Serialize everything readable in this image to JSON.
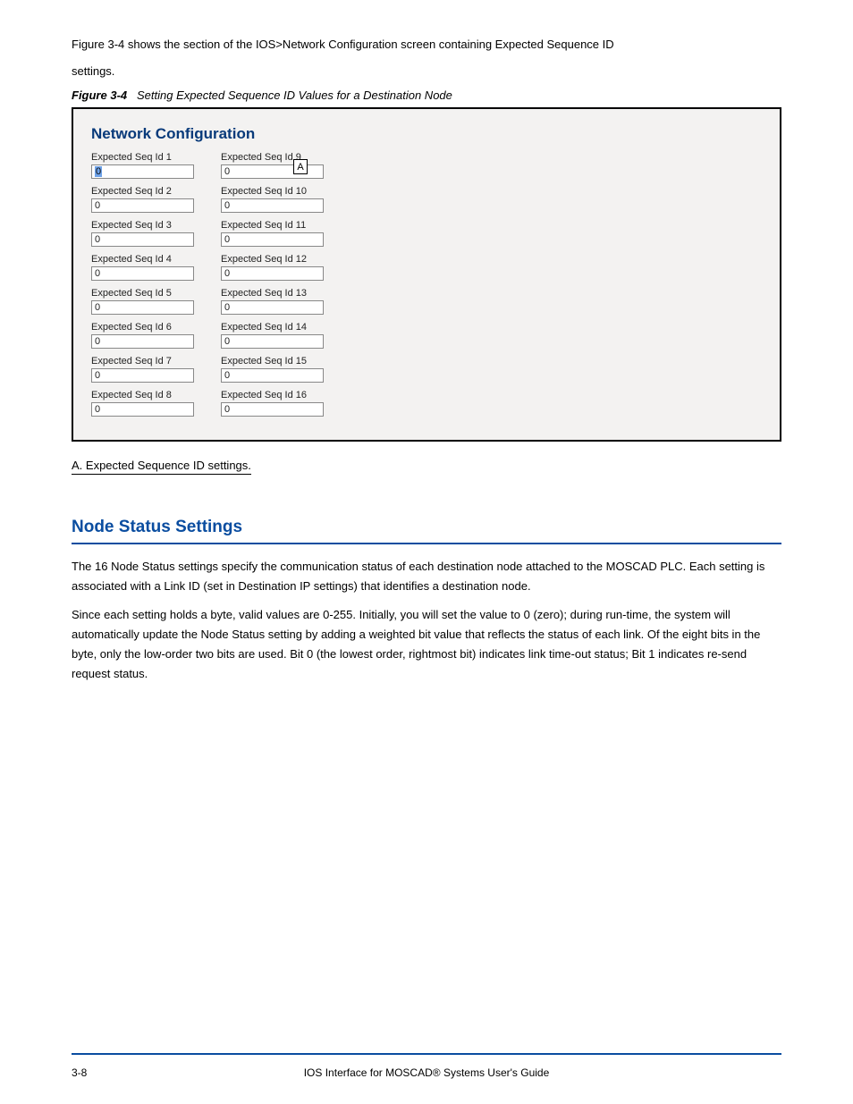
{
  "intro": {
    "line1": "Figure 3-4 shows the section of the IOS>Network Configuration screen containing Expected Sequence ID",
    "line2": "settings."
  },
  "figure": {
    "label": "Figure 3-4",
    "caption": "Setting Expected Sequence ID Values for a Destination Node"
  },
  "panel": {
    "title": "Network Configuration",
    "callout_letter": "A",
    "col1": [
      {
        "label": "Expected Seq Id 1",
        "value": "0",
        "selected": true
      },
      {
        "label": "Expected Seq Id 2",
        "value": "0"
      },
      {
        "label": "Expected Seq Id 3",
        "value": "0"
      },
      {
        "label": "Expected Seq Id 4",
        "value": "0"
      },
      {
        "label": "Expected Seq Id 5",
        "value": "0"
      },
      {
        "label": "Expected Seq Id 6",
        "value": "0"
      },
      {
        "label": "Expected Seq Id 7",
        "value": "0"
      },
      {
        "label": "Expected Seq Id 8",
        "value": "0"
      }
    ],
    "col2": [
      {
        "label": "Expected Seq Id 9",
        "value": "0"
      },
      {
        "label": "Expected Seq Id 10",
        "value": "0"
      },
      {
        "label": "Expected Seq Id 11",
        "value": "0"
      },
      {
        "label": "Expected Seq Id 12",
        "value": "0"
      },
      {
        "label": "Expected Seq Id 13",
        "value": "0"
      },
      {
        "label": "Expected Seq Id 14",
        "value": "0"
      },
      {
        "label": "Expected Seq Id 15",
        "value": "0"
      },
      {
        "label": "Expected Seq Id 16",
        "value": "0"
      }
    ]
  },
  "callout_desc": "A. Expected Sequence ID settings.",
  "section": {
    "heading": "Node Status Settings",
    "p1": "The 16 Node Status settings specify the communication status of each destination node attached to the MOSCAD PLC. Each setting is associated with a Link ID (set in Destination IP settings) that identifies a destination node.",
    "p2": "Since each setting holds a byte, valid values are 0-255. Initially, you will set the value to 0 (zero); during run-time, the system will automatically update the Node Status setting by adding a weighted bit value that reflects the status of each link. Of the eight bits in the byte, only the low-order two bits are used. Bit 0 (the lowest order, rightmost bit) indicates link time-out status; Bit 1 indicates re-send request status."
  },
  "footer": {
    "left": "3-8",
    "center_prefix": "IOS Interface for MOSCAD",
    "center_reg": "®",
    "center_suffix": " Systems User's Guide",
    "right": ""
  }
}
